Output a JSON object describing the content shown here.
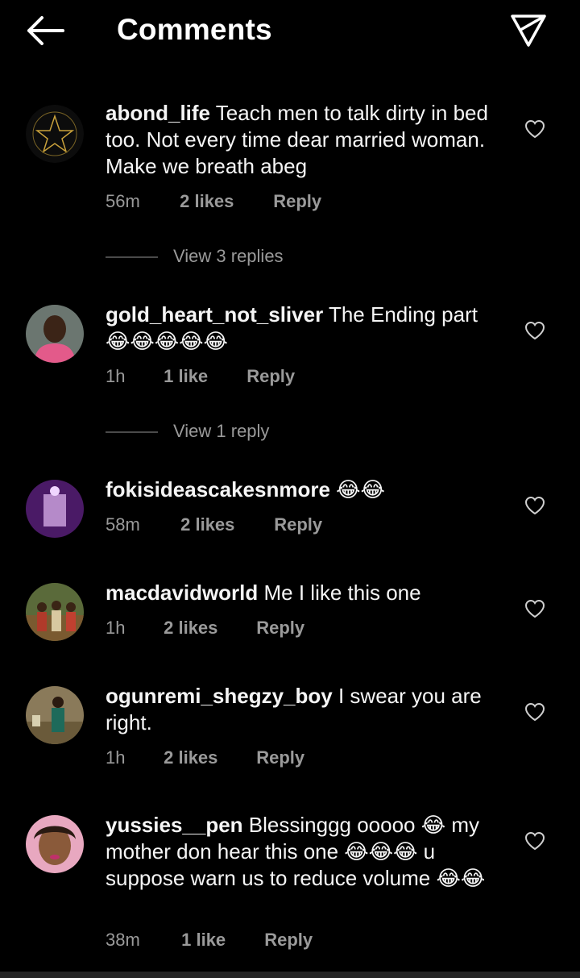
{
  "header": {
    "title": "Comments",
    "back_icon": "arrow-left-icon",
    "share_icon": "paper-plane-icon"
  },
  "comments": [
    {
      "user": "abond_life",
      "text": "Teach men to talk dirty in bed too. Not every time  dear married woman. Make we breath abeg",
      "time": "56m",
      "likes": "2 likes",
      "reply": "Reply",
      "view_replies": "View 3 replies"
    },
    {
      "user": "gold_heart_not_sliver",
      "text": "The Ending part 😂😂😂😂😂",
      "time": "1h",
      "likes": "1 like",
      "reply": "Reply",
      "view_replies": "View 1 reply"
    },
    {
      "user": "fokisideascakesnmore",
      "text": "😂😂",
      "time": "58m",
      "likes": "2 likes",
      "reply": "Reply"
    },
    {
      "user": "macdavidworld",
      "text": "Me I like this one",
      "time": "1h",
      "likes": "2 likes",
      "reply": "Reply"
    },
    {
      "user": "ogunremi_shegzy_boy",
      "text": "I swear you are right.",
      "time": "1h",
      "likes": "2 likes",
      "reply": "Reply"
    },
    {
      "user": "yussies__pen",
      "text": "Blessinggg ooooo 😂 my mother don hear this one 😂😂😂 u suppose warn us to reduce volume 😂😂",
      "time": "38m",
      "likes": "1 like",
      "reply": "Reply"
    }
  ],
  "colors": {
    "background": "#000000",
    "secondary_text": "#9a9a9a"
  }
}
